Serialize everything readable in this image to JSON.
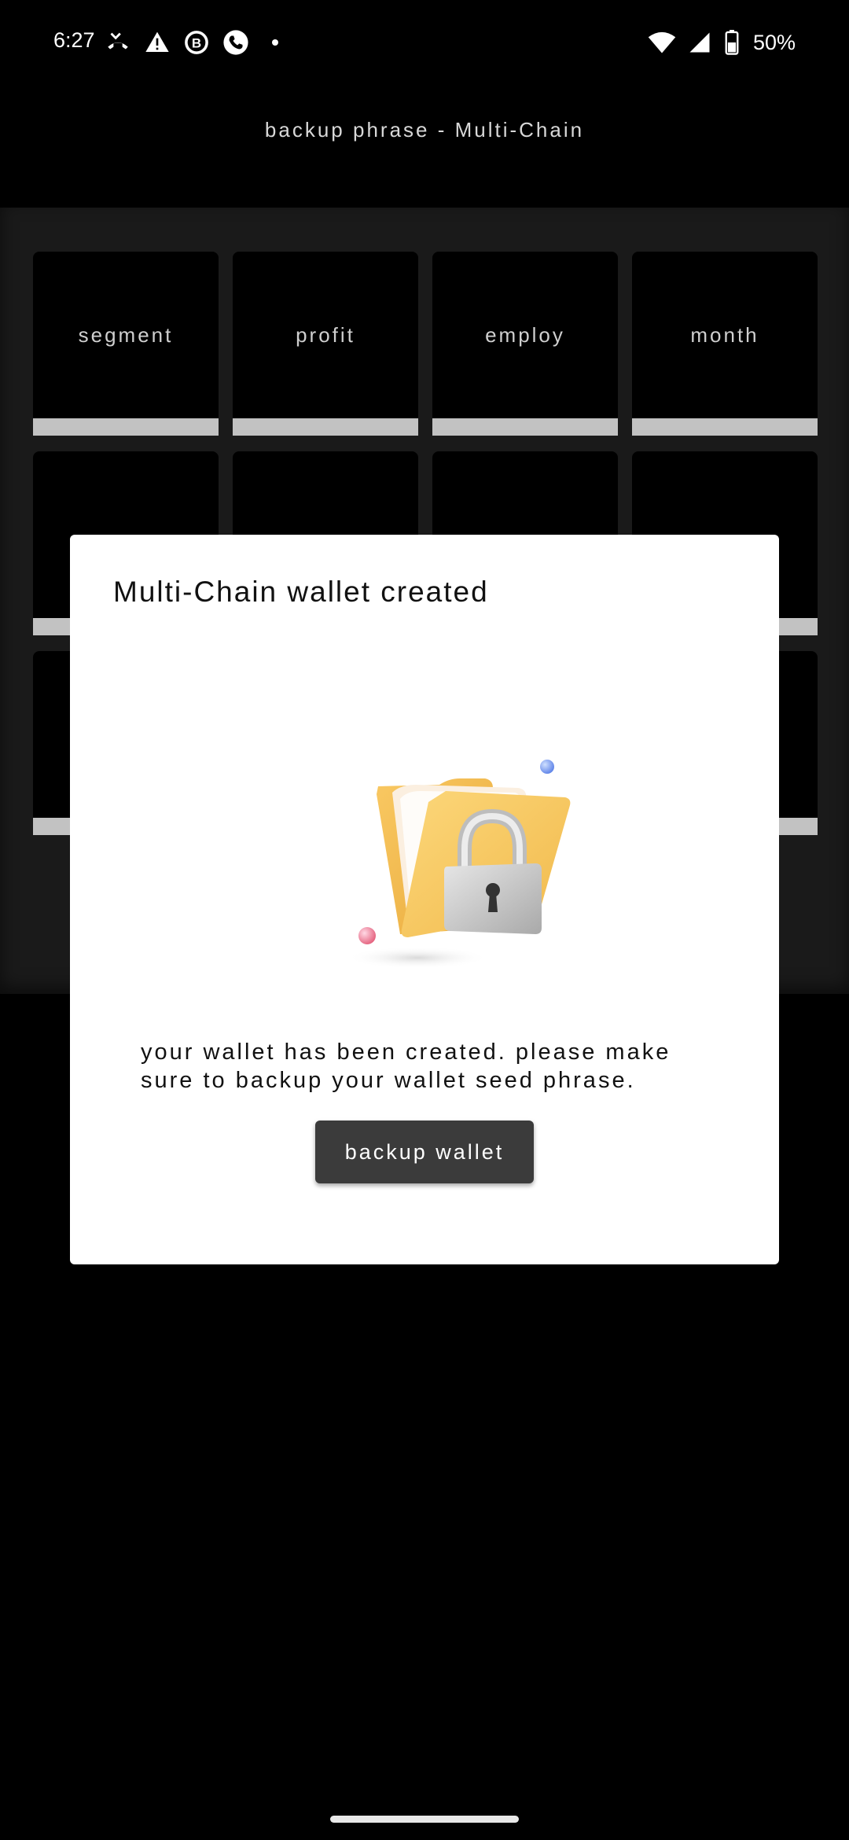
{
  "status_bar": {
    "time": "6:27",
    "battery": "50%",
    "icons": [
      "missed-call-icon",
      "warning-icon",
      "b-app-icon",
      "phone-icon",
      "dot-icon",
      "wifi-icon",
      "signal-icon",
      "battery-icon"
    ]
  },
  "header": {
    "title": "backup phrase - Multi-Chain"
  },
  "phrase": {
    "words": [
      "segment",
      "profit",
      "employ",
      "month",
      "",
      "",
      "",
      "",
      "",
      "",
      "",
      ""
    ]
  },
  "dialog": {
    "title": "Multi-Chain wallet created",
    "message": "your wallet has been created. please make sure to backup your wallet seed phrase.",
    "button_label": "backup wallet",
    "illustration": "folder-lock-icon"
  },
  "colors": {
    "background": "#000000",
    "panel": "#1a1a1a",
    "card_bar": "#c2c2c2",
    "dialog": "#ffffff",
    "button": "#3b3b3b",
    "folder": "#f7c35c"
  }
}
